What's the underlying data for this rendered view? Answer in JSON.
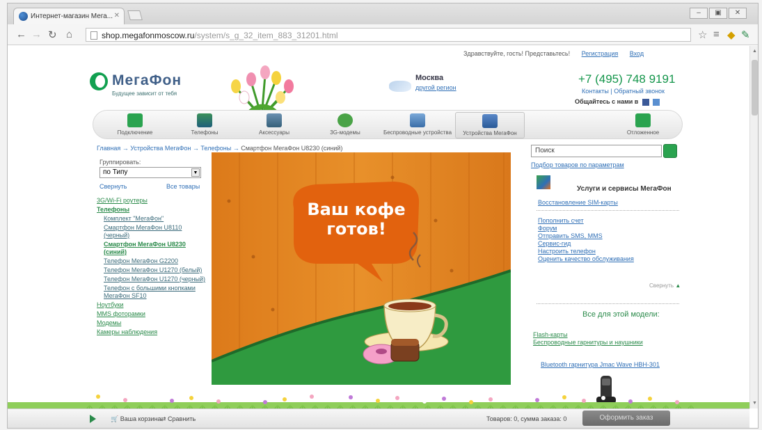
{
  "browser": {
    "tab_title": "Интернет-магазин Мега...",
    "url_host": "shop.megafonmoscow.ru",
    "url_path": "/system/s_g_32_item_883_31201.html",
    "window_buttons": [
      "–",
      "▣",
      "✕"
    ]
  },
  "header": {
    "toplinks_greeting": "Здравствуйте, гость! Представьтесь!",
    "toplinks_register": "Регистрация",
    "toplinks_login": "Вход",
    "logo_name": "МегаФон",
    "logo_slogan": "Будущее зависит от тебя",
    "city": "Москва",
    "change_region": "другой регион",
    "phone": "+7 (495) 748 9191",
    "contacts": "Контакты | Обратный звонок",
    "social": "Общайтесь с нами в"
  },
  "categories": [
    {
      "label": "Подключение"
    },
    {
      "label": "Телефоны"
    },
    {
      "label": "Аксессуары"
    },
    {
      "label": "3G-модемы"
    },
    {
      "label": "Беспроводные устройства"
    },
    {
      "label": "Устройства МегаФон"
    },
    {
      "label": "Отложенное"
    }
  ],
  "breadcrumb": {
    "home": "Главная",
    "l1": "Устройства МегаФон",
    "l2": "Телефоны",
    "current": "Смартфон МегаФон U8230 (синий)"
  },
  "sidebar": {
    "group_label": "Группировать:",
    "group_value": "по Типу",
    "link_left": "Свернуть",
    "link_right": "Все товары",
    "items": [
      {
        "label": "3G/Wi-Fi роутеры",
        "sub": false,
        "bold": false
      },
      {
        "label": "Телефоны",
        "sub": false,
        "bold": true
      },
      {
        "label": "Комплект \"МегаФон\"",
        "sub": true,
        "bold": false
      },
      {
        "label": "Смартфон МегаФон U8110 (черный)",
        "sub": true,
        "bold": false
      },
      {
        "label": "Смартфон МегаФон U8230 (синий)",
        "sub": true,
        "bold": true
      },
      {
        "label": "Телефон МегаФон G2200",
        "sub": true,
        "bold": false
      },
      {
        "label": "Телефон МегаФон U1270 (белый)",
        "sub": true,
        "bold": false
      },
      {
        "label": "Телефон МегаФон U1270 (черный)",
        "sub": true,
        "bold": false
      },
      {
        "label": "Телефон с большими кнопками МегаФон SF10",
        "sub": true,
        "bold": false
      },
      {
        "label": "Ноутбуки",
        "sub": false,
        "bold": false
      },
      {
        "label": "MMS фоторамки",
        "sub": false,
        "bold": false
      },
      {
        "label": "Модемы",
        "sub": false,
        "bold": false
      },
      {
        "label": "Камеры наблюдения",
        "sub": false,
        "bold": false
      }
    ]
  },
  "hero": {
    "bubble_line1": "Ваш кофе",
    "bubble_line2": "готов!"
  },
  "right": {
    "search_placeholder": "Поиск",
    "pick_by_params": "Подбор товаров по параметрам",
    "services_title": "Услуги и сервисы МегаФон",
    "list_a": [
      "Восстановление SIM-карты"
    ],
    "list_b": [
      "Пополнить счет",
      "Форум",
      "Отправить SMS, MMS",
      "Сервис-гид",
      "Настроить телефон",
      "Оценить качество обслуживания"
    ],
    "more": "Свернуть",
    "all_for_model": "Все для этой модели:",
    "list_c": [
      "Flash-карты",
      "Беспроводные гарнитуры и наушники"
    ],
    "bt_headset": "Bluetooth гарнитура Jmac Wave HBH-301"
  },
  "bottombar": {
    "cart": "Ваша корзина",
    "compare": "Сравнить",
    "summary": "Товаров: 0, сумма заказа: 0",
    "order": "Оформить заказ"
  },
  "colors": {
    "brand_green": "#13954a",
    "link_blue": "#2f6fb6",
    "hero_orange": "#e0841f",
    "bubble_orange": "#e2620e"
  }
}
